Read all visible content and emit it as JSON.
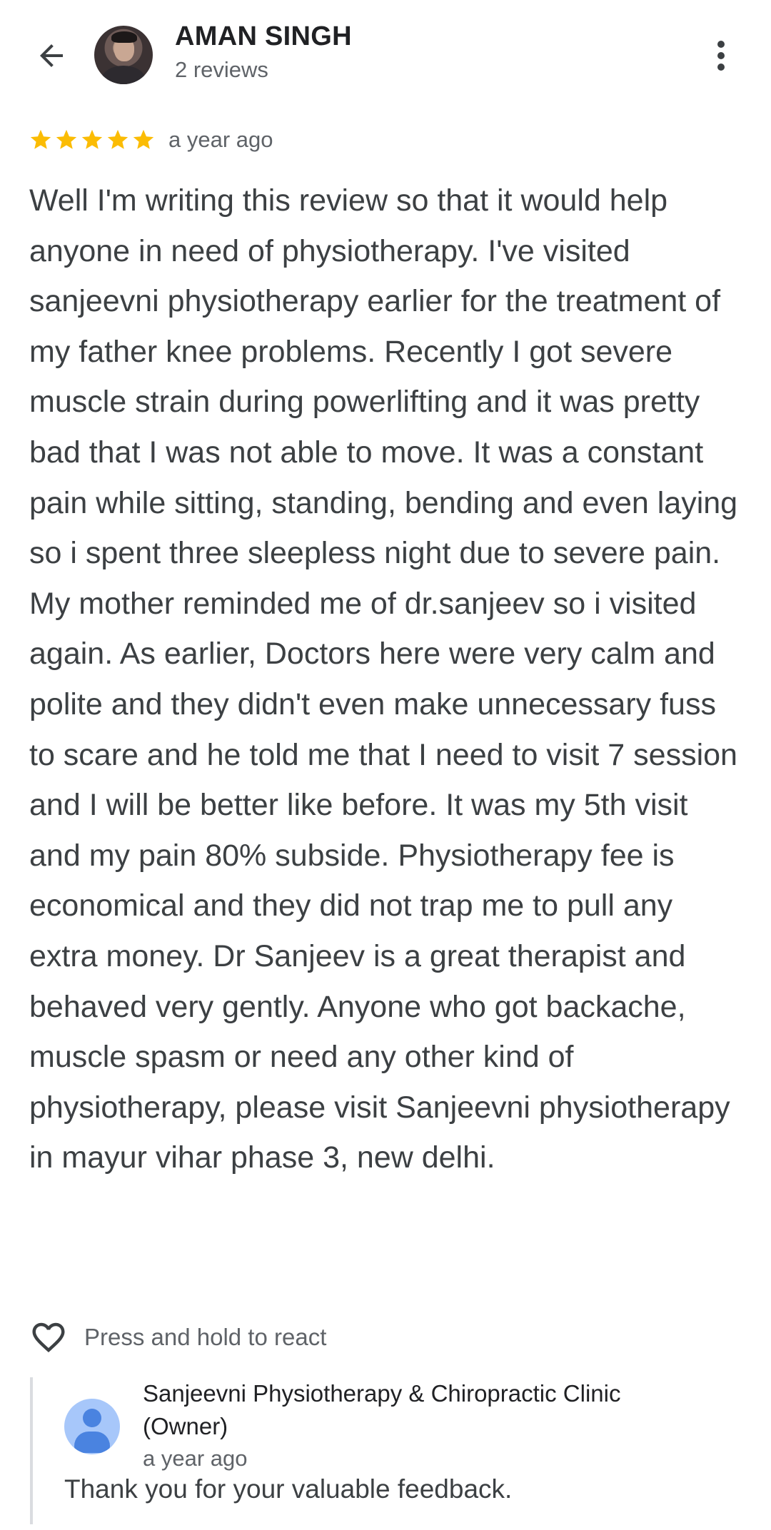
{
  "header": {
    "user_name": "AMAN SINGH",
    "review_count": "2 reviews",
    "back_icon": "arrow-back-icon",
    "more_icon": "more-vert-icon"
  },
  "review": {
    "rating": 5,
    "max_rating": 5,
    "star_color": "#fbbc04",
    "time": "a year ago",
    "text": "Well I'm writing this review so that it would help anyone in need of physiotherapy. I've visited sanjeevni physiotherapy earlier for the treatment of my father knee problems. Recently I got severe muscle strain during powerlifting and it was pretty bad that I was not able to move. It was a constant pain while sitting, standing, bending and even laying so i spent three sleepless night due to severe pain. My mother reminded me of dr.sanjeev so i visited again. As earlier, Doctors here were very calm and polite and they didn't even make unnecessary fuss to scare and he told me that I need to visit 7 session and I will be better like before. It was my 5th visit and my pain 80% subside. Physiotherapy fee is economical and they did not trap me to pull any extra money. Dr Sanjeev is a great therapist and behaved very gently. Anyone who got backache, muscle spasm or need any other kind of physiotherapy, please visit Sanjeevni physiotherapy in mayur vihar phase 3, new delhi."
  },
  "react": {
    "label": "Press and hold to react",
    "icon": "heart-outline-icon"
  },
  "owner_reply": {
    "name": "Sanjeevni Physiotherapy & Chiropractic Clinic (Owner)",
    "time": "a year ago",
    "text": "Thank you for your valuable feedback.",
    "avatar_color": "#a7c7fa"
  }
}
